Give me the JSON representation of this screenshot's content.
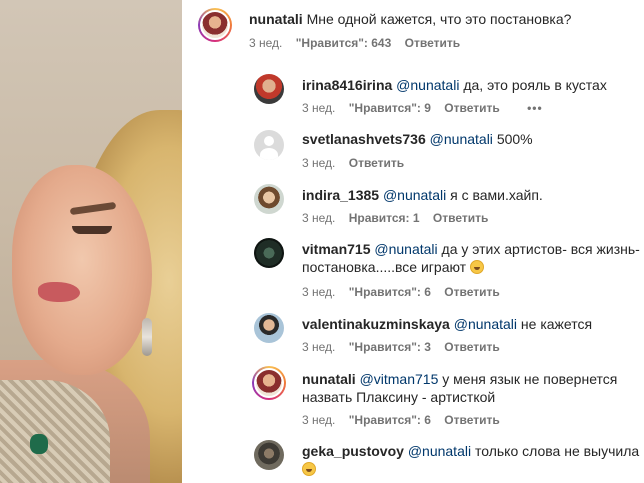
{
  "main_comment": {
    "username": "nunatali",
    "text": "Мне одной кажется, что это постановка?",
    "time": "3 нед.",
    "likes": "\"Нравится\": 643",
    "reply": "Ответить"
  },
  "replies": [
    {
      "username": "irina8416irina",
      "mention": "@nunatali",
      "text": "да, это рояль в кустах",
      "time": "3 нед.",
      "likes": "\"Нравится\": 9",
      "reply": "Ответить",
      "more": "•••"
    },
    {
      "username": "svetlanashvets736",
      "mention": "@nunatali",
      "text": "500%",
      "time": "3 нед.",
      "likes": "",
      "reply": "Ответить"
    },
    {
      "username": "indira_1385",
      "mention": "@nunatali",
      "text": "я с вами.хайп.",
      "time": "3 нед.",
      "likes": "Нравится: 1",
      "reply": "Ответить"
    },
    {
      "username": "vitman715",
      "mention": "@nunatali",
      "text": "да у этих артистов- вся жизнь-",
      "text2": "постановка.....все играют",
      "time": "3 нед.",
      "likes": "\"Нравится\": 6",
      "reply": "Ответить"
    },
    {
      "username": "valentinakuzminskaya",
      "mention": "@nunatali",
      "text": "не кажется",
      "time": "3 нед.",
      "likes": "\"Нравится\": 3",
      "reply": "Ответить"
    },
    {
      "username": "nunatali",
      "mention": "@vitman715",
      "text": "у меня язык не повернется",
      "text2": "назвать Плаксину - артисткой",
      "time": "3 нед.",
      "likes": "\"Нравится\": 6",
      "reply": "Ответить"
    },
    {
      "username": "geka_pustovoy",
      "mention": "@nunatali",
      "text": "только слова не выучила",
      "time": "",
      "likes": "",
      "reply": ""
    }
  ],
  "colors": {
    "username": "#262626",
    "mention": "#00376b",
    "meta": "#737373",
    "ring_gradient": [
      "#f9c152",
      "#d62e7c",
      "#8a3ab9"
    ]
  },
  "icons": {
    "emoji": "grinning-face-emoji",
    "default_avatar": "default-user-silhouette-icon",
    "more": "more-dots-icon"
  }
}
